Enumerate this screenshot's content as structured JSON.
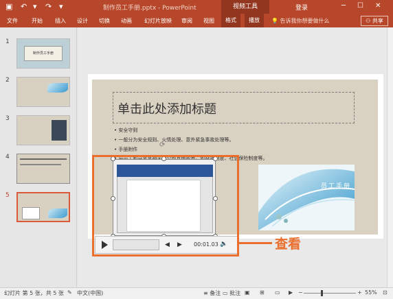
{
  "window": {
    "title": "制作员工手册.pptx - PowerPoint",
    "tool_group": "视频工具",
    "login": "登录",
    "window_controls": [
      "minimize-icon",
      "maximize-icon",
      "close-icon"
    ]
  },
  "quick_access": {
    "save_icon": "save-icon",
    "undo_icon": "undo-icon",
    "redo_icon": "redo-icon",
    "custom_icon": "customize-icon"
  },
  "ribbon": {
    "tabs": [
      "文件",
      "开始",
      "插入",
      "设计",
      "切换",
      "动画",
      "幻灯片放映",
      "审阅",
      "视图",
      "格式",
      "播放"
    ],
    "help": "告诉我你想要做什么",
    "share": "共享"
  },
  "thumbnails": [
    {
      "num": "1",
      "label": "制作员工手册"
    },
    {
      "num": "2"
    },
    {
      "num": "3"
    },
    {
      "num": "4"
    },
    {
      "num": "5"
    }
  ],
  "slide": {
    "title_placeholder": "单击此处添加标题",
    "bullets": [
      "安全守则",
      "一般分为安全规则、火情处理、意外紧急事故处理等。",
      "手册附件",
      "与员工利益息息相关的公司其他政策，如财务制度、社会保险制度等。"
    ],
    "deco_text": "员工手册"
  },
  "player": {
    "time": "00:01.03"
  },
  "callout": {
    "label": "查看"
  },
  "status": {
    "slide_info": "幻灯片 第 5 张，共 5 张",
    "language": "中文(中国)",
    "notes": "备注",
    "comments": "批注",
    "zoom": "55%"
  },
  "colors": {
    "accent": "#b7472a",
    "callout": "#ea6f2d"
  }
}
